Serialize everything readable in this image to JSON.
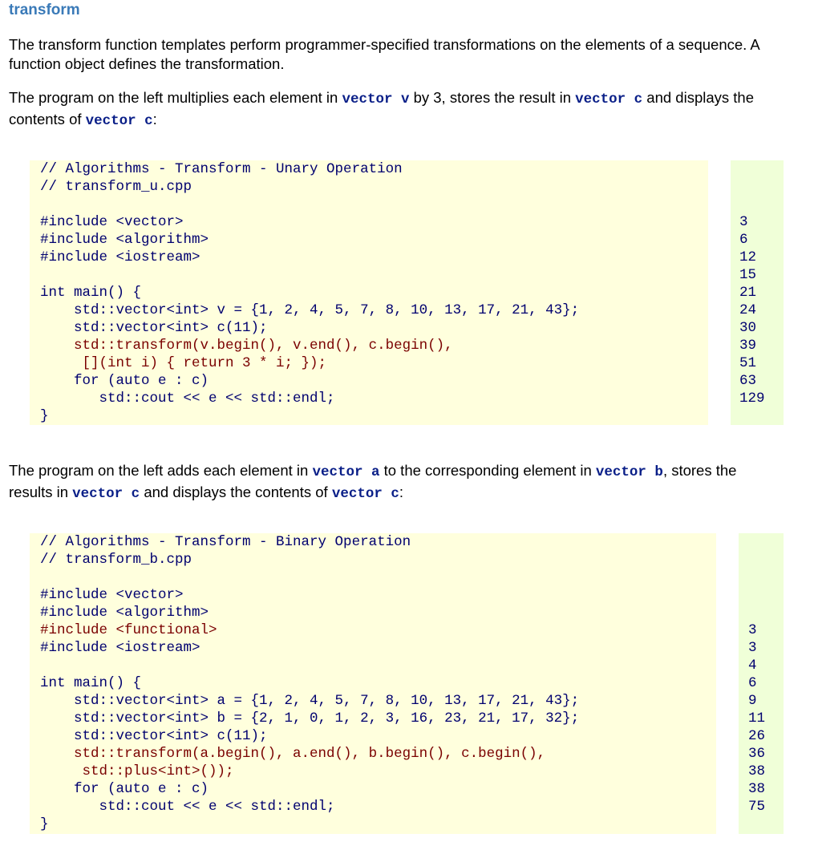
{
  "heading": "transform",
  "intro": [
    "The transform function templates perform programmer-specified transformations on the elements of a sequence.  A",
    "function object defines the transformation."
  ],
  "para1": {
    "t1": "The program on the left multiplies each element in ",
    "k1": "vector v",
    "t2": " by 3, stores the result in ",
    "k2": "vector c",
    "t3": " and displays the",
    "t4": "contents of ",
    "k3": "vector c",
    "t5": ":"
  },
  "example1": {
    "code": [
      "// Algorithms - Transform - Unary Operation",
      "// transform_u.cpp",
      "",
      "#include <vector>",
      "#include <algorithm>",
      "#include <iostream>",
      "",
      "int main() {",
      "    std::vector<int> v = {1, 2, 4, 5, 7, 8, 10, 13, 17, 21, 43};",
      "    std::vector<int> c(11);",
      "    std::transform(v.begin(), v.end(), c.begin(),",
      "     [](int i) { return 3 * i; });",
      "    for (auto e : c)",
      "       std::cout << e << std::endl;",
      "}"
    ],
    "output": [
      "3",
      "6",
      "12",
      "15",
      "21",
      "24",
      "30",
      "39",
      "51",
      "63",
      "129"
    ]
  },
  "para2": {
    "t1": "The program on the left adds each element in ",
    "k1": "vector a",
    "t2": " to the corresponding element in ",
    "k2": "vector b",
    "t3": ", stores the",
    "t4": "results in ",
    "k3": "vector c",
    "t5": " and displays the contents of ",
    "k4": "vector c",
    "t6": ":"
  },
  "example2": {
    "code": [
      "// Algorithms - Transform - Binary Operation",
      "// transform_b.cpp",
      "",
      "#include <vector>",
      "#include <algorithm>",
      "#include <functional>",
      "#include <iostream>",
      "",
      "int main() {",
      "    std::vector<int> a = {1, 2, 4, 5, 7, 8, 10, 13, 17, 21, 43};",
      "    std::vector<int> b = {2, 1, 0, 1, 2, 3, 16, 23, 21, 17, 32};",
      "    std::vector<int> c(11);",
      "    std::transform(a.begin(), a.end(), b.begin(), c.begin(),",
      "     std::plus<int>());",
      "    for (auto e : c)",
      "       std::cout << e << std::endl;",
      "}"
    ],
    "output": [
      "3",
      "3",
      "4",
      "6",
      "9",
      "11",
      "26",
      "36",
      "38",
      "38",
      "75"
    ]
  }
}
